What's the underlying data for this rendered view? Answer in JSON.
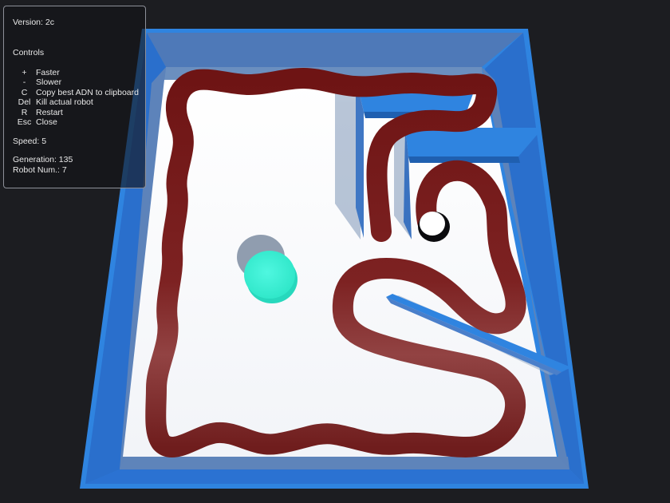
{
  "hud": {
    "version": "Version: 2c",
    "controls_title": "Controls",
    "controls": [
      {
        "key": "+",
        "action": "Faster"
      },
      {
        "key": "-",
        "action": "Slower"
      },
      {
        "key": "C",
        "action": "Copy best ADN to clipboard"
      },
      {
        "key": "Del",
        "action": "Kill actual robot"
      },
      {
        "key": "R",
        "action": "Restart"
      },
      {
        "key": "Esc",
        "action": "Close"
      }
    ],
    "speed": "Speed: 5",
    "generation": "Generation: 135",
    "robot_num": "Robot Num.: 7"
  },
  "scene": {
    "colors": {
      "background": "#1c1d21",
      "wall": "#2f84e0",
      "wall_dark": "#1f5fb0",
      "floor": "#ffffff",
      "trail": "#7b1c1c",
      "goal": "#38f2d7",
      "robot": "#ffffff"
    }
  }
}
